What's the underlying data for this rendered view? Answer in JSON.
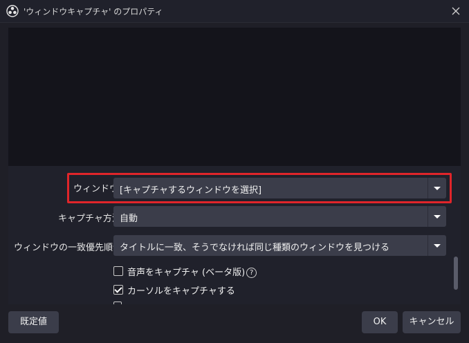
{
  "window": {
    "title": "'ウィンドウキャプチャ' のプロパティ",
    "app_icon": "obs-logo-icon",
    "close_icon": "close-icon"
  },
  "form": {
    "window_label": "ウィンドウ",
    "window_value": "[キャプチャするウィンドウを選択]",
    "capture_method_label": "キャプチャ方法",
    "capture_method_value": "自動",
    "match_priority_label": "ウィンドウの一致優先順位",
    "match_priority_value": "タイトルに一致、そうでなければ同じ種類のウィンドウを見つける",
    "capture_audio_label": "音声をキャプチャ (ベータ版)",
    "capture_audio_checked": false,
    "capture_cursor_label": "カーソルをキャプチャする",
    "capture_cursor_checked": true,
    "help_glyph": "?"
  },
  "buttons": {
    "defaults": "既定値",
    "ok": "OK",
    "cancel": "キャンセル"
  },
  "colors": {
    "highlight": "#e0252a",
    "background": "#1f1f27",
    "control": "#3b3d4a"
  }
}
